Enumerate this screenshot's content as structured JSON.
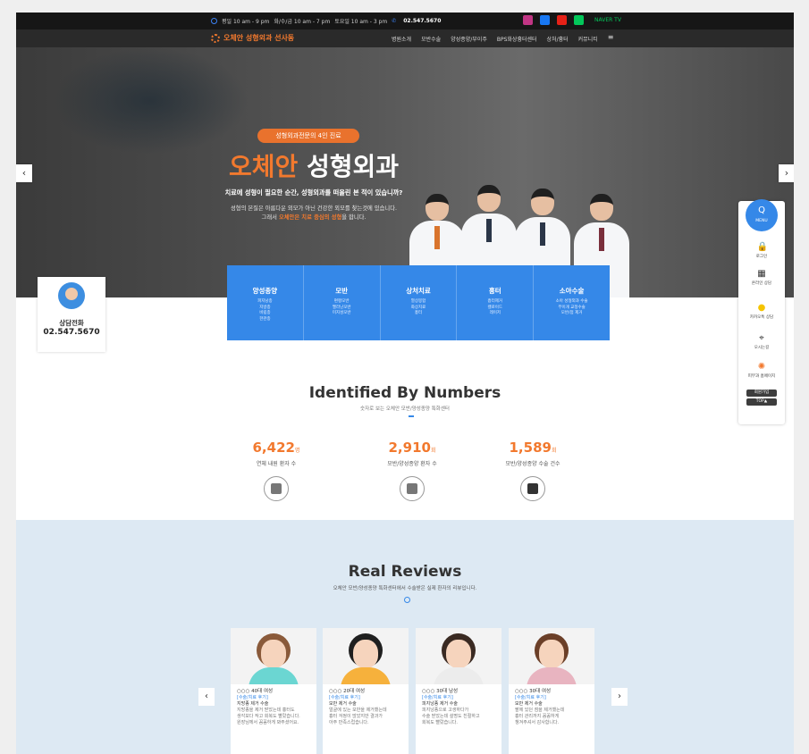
{
  "topbar": {
    "hours": [
      "평일 10 am - 9 pm",
      "화/수/금 10 am - 7 pm",
      "토요일 10 am - 3 pm"
    ],
    "phone": "02.547.5670",
    "naver": "NAVER TV"
  },
  "nav": {
    "logo": "오체안 성형외과 선사동",
    "items": [
      "병원소개",
      "모반수술",
      "양성종양/부이주",
      "BPS화상흉터센터",
      "상처/흉터",
      "커뮤니티"
    ]
  },
  "hero": {
    "badge": "성형외과전문의 4인 진료",
    "title_accent": "오체안",
    "title_rest": "성형외과",
    "subtitle": "치료에 성형이 필요한 순간, 성형외과를 떠올린 본 적이 있습니까?",
    "desc_line1": "성형의 본질은 아름다운 외모가 아닌 건강한 외모를 찾는것에 있습니다.",
    "desc_line2_pre": "그래서 ",
    "desc_line2_accent": "오체안은 치료 중심의 성형",
    "desc_line2_post": "을 합니다.",
    "arrow_left": "‹",
    "arrow_right": "›"
  },
  "categories": [
    {
      "title": "양성종양",
      "items": [
        "피지낭종",
        "지방종",
        "비립종",
        "한관종"
      ]
    },
    {
      "title": "모반",
      "items": [
        "편평모반",
        "멜라닌모반",
        "미지성모반"
      ]
    },
    {
      "title": "상처치료",
      "items": [
        "열상봉합",
        "화상치료",
        "흉터"
      ]
    },
    {
      "title": "흉터",
      "items": [
        "흉터제거",
        "켈로이드",
        "레이저"
      ]
    },
    {
      "title": "소아수술",
      "items": [
        "소아 성형외과 수술",
        "부이개 교정수술",
        "모반/점 제거"
      ]
    }
  ],
  "consult": {
    "label": "상담전화",
    "phone": "02.547.5670"
  },
  "numbers": {
    "title": "Identified By Numbers",
    "subtitle": "숫자로 보는 오체안 모반/양성종양 특화센터",
    "stats": [
      {
        "value": "6,422",
        "unit": "명",
        "label": "연체 내원 환자 수"
      },
      {
        "value": "2,910",
        "unit": "회",
        "label": "모반/양성종양 환자 수"
      },
      {
        "value": "1,589",
        "unit": "회",
        "label": "모반/양성종양 수술 건수"
      }
    ]
  },
  "reviews": {
    "title": "Real Reviews",
    "subtitle": "오체안 모반/양성종양 특화센터에서 수술받은 실제 환자의 리뷰입니다.",
    "arrow_left": "‹",
    "arrow_right": "›",
    "cards": [
      {
        "name": "○○○ 40대 여성",
        "tag": "[수술/치료 후기]",
        "proc": "지방종 제거 수술",
        "text": [
          "지방종을 제거 받았는데 흉터도",
          "생각보다 작고 회복도 빨랐습니다.",
          "원장님께서 꼼꼼하게 봐주셨어요."
        ],
        "body": "#6bd6d2",
        "hair": "#8a5a3a"
      },
      {
        "name": "○○○ 20대 여성",
        "tag": "[수술/치료 후기]",
        "proc": "모반 제거 수술",
        "text": [
          "얼굴에 있는 모반을 제거했는데",
          "흉터 걱정이 많았지만 결과가",
          "아주 만족스럽습니다."
        ],
        "body": "#f6b13c",
        "hair": "#1f1f1f"
      },
      {
        "name": "○○○ 30대 남성",
        "tag": "[수술/치료 후기]",
        "proc": "피지낭종 제거 수술",
        "text": [
          "피지낭종으로 고생하다가",
          "수술 받았는데 설명도 친절하고",
          "회복도 빨랐습니다."
        ],
        "body": "#ececec",
        "hair": "#3a2a22"
      },
      {
        "name": "○○○ 30대 여성",
        "tag": "[수술/치료 후기]",
        "proc": "모반 제거 수술",
        "text": [
          "팔에 있던 점을 제거했는데",
          "흉터 관리까지 꼼꼼하게",
          "챙겨주셔서 감사합니다."
        ],
        "body": "#e8b4c0",
        "hair": "#6b3f28"
      }
    ]
  },
  "side": {
    "menu": "Q",
    "menu_label": "MENU",
    "items": [
      {
        "icon": "🔒",
        "label": "로그인"
      },
      {
        "icon": "▦",
        "label": "온라인 상담"
      },
      {
        "icon": "●",
        "label": "카카오톡 상담"
      },
      {
        "icon": "⌖",
        "label": "오시는길"
      },
      {
        "icon": "✺",
        "label": "피부과 홈페이지"
      }
    ],
    "join": "회원가입",
    "top": "TOP▲"
  }
}
